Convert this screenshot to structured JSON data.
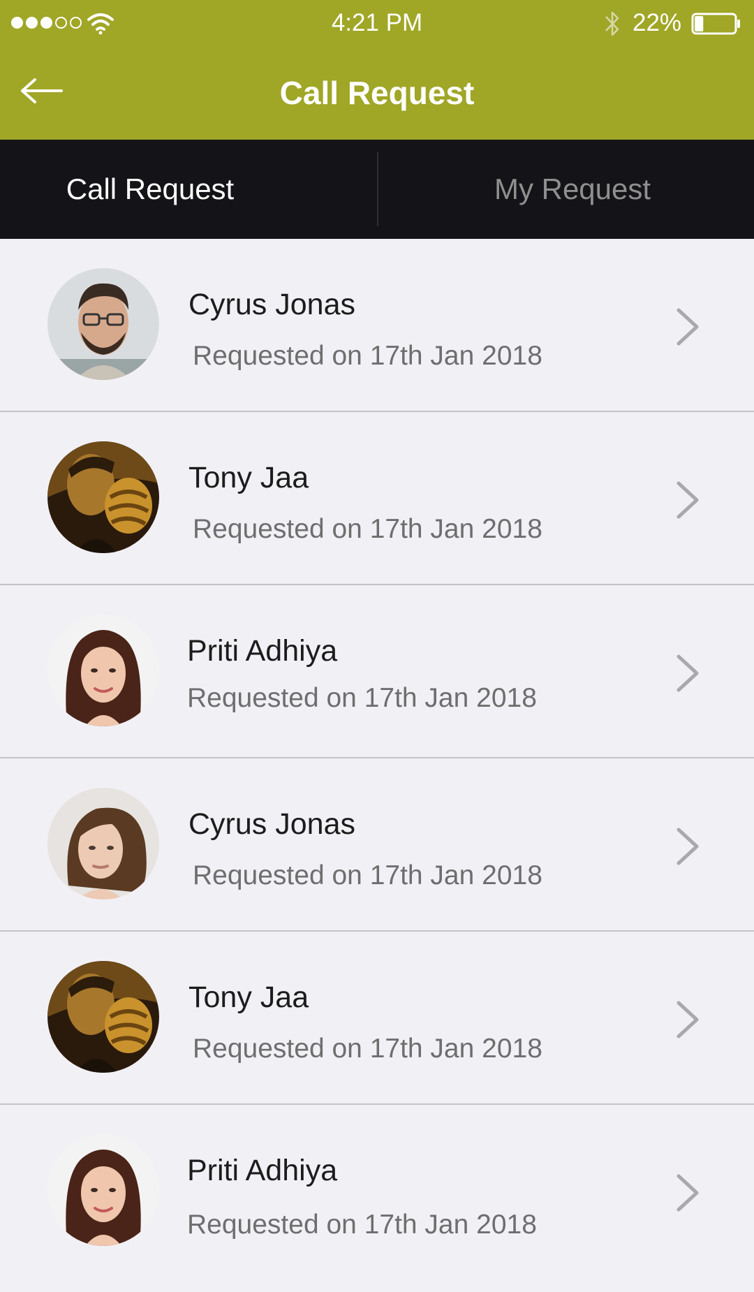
{
  "status_bar": {
    "time": "4:21 PM",
    "battery": "22%",
    "signal_icon": "signal-dots-icon",
    "wifi_icon": "wifi-icon",
    "bluetooth_icon": "bluetooth-icon",
    "battery_icon": "battery-icon",
    "battery_level": 0.22
  },
  "header": {
    "title": "Call Request",
    "back_icon": "arrow-left-icon"
  },
  "tabs": [
    {
      "label": "Call Request",
      "active": true
    },
    {
      "label": "My Request",
      "active": false
    }
  ],
  "requests": [
    {
      "name": "Cyrus Jonas",
      "date": "Requested on 17th Jan 2018"
    },
    {
      "name": "Tony Jaa",
      "date": "Requested on 17th Jan 2018"
    },
    {
      "name": "Priti Adhiya",
      "date": "Requested on 17th Jan 2018"
    },
    {
      "name": "Cyrus Jonas",
      "date": "Requested on 17th Jan 2018"
    },
    {
      "name": "Tony Jaa",
      "date": "Requested on 17th Jan 2018"
    },
    {
      "name": "Priti Adhiya",
      "date": "Requested on 17th Jan 2018"
    }
  ],
  "colors": {
    "header_bg": "#a0a626",
    "tab_bar_bg": "#141418",
    "list_bg": "#f1f0f5",
    "active_tab_text": "#ffffff",
    "inactive_tab_text": "#8f8f8f",
    "secondary_text": "#6e6e6e",
    "chevron": "#a9a9ad"
  }
}
